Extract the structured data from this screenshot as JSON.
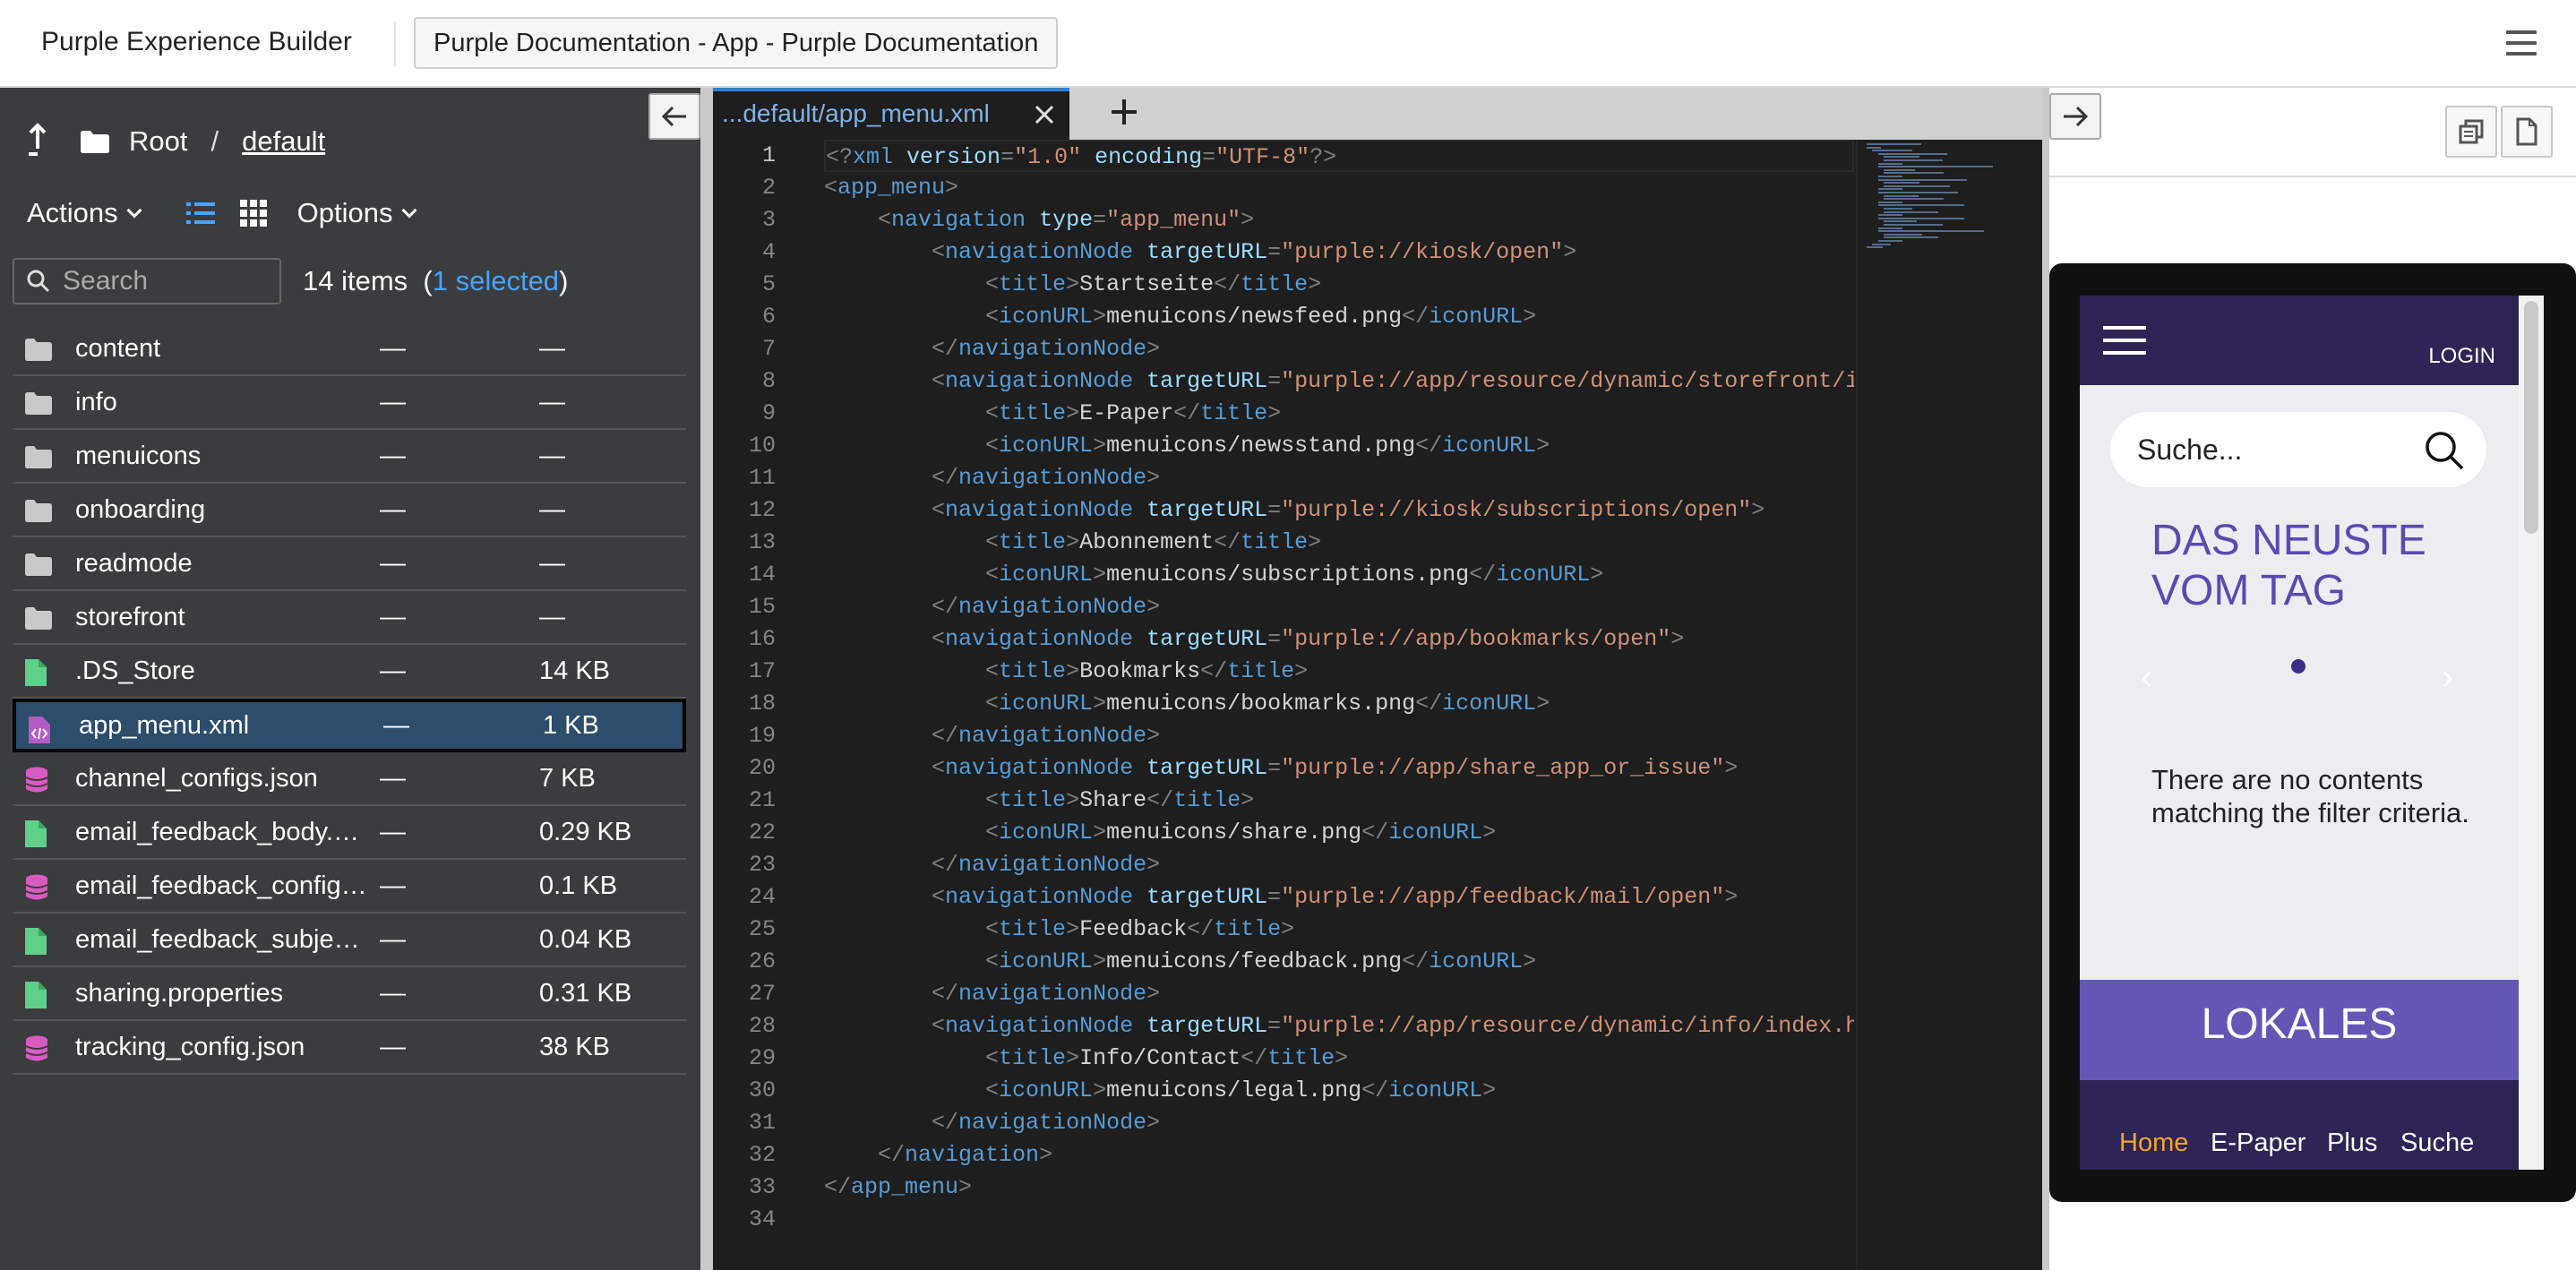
{
  "app": {
    "title": "Purple Experience Builder",
    "project_button": "Purple Documentation - App - Purple Documentation"
  },
  "browser": {
    "breadcrumb_root": "Root",
    "breadcrumb_sep": "/",
    "breadcrumb_current": "default",
    "actions_label": "Actions",
    "options_label": "Options",
    "search_placeholder": "Search",
    "items_count": "14 items",
    "paren_open": "(",
    "selected_count": "1 selected",
    "paren_close": ")",
    "files": [
      {
        "name": "content",
        "modified": "—",
        "size": "—",
        "type": "folder"
      },
      {
        "name": "info",
        "modified": "—",
        "size": "—",
        "type": "folder"
      },
      {
        "name": "menuicons",
        "modified": "—",
        "size": "—",
        "type": "folder"
      },
      {
        "name": "onboarding",
        "modified": "—",
        "size": "—",
        "type": "folder"
      },
      {
        "name": "readmode",
        "modified": "—",
        "size": "—",
        "type": "folder"
      },
      {
        "name": "storefront",
        "modified": "—",
        "size": "—",
        "type": "folder"
      },
      {
        "name": ".DS_Store",
        "modified": "—",
        "size": "14 KB",
        "type": "file"
      },
      {
        "name": "app_menu.xml",
        "modified": "—",
        "size": "1 KB",
        "type": "xml",
        "selected": true
      },
      {
        "name": "channel_configs.json",
        "modified": "—",
        "size": "7 KB",
        "type": "json"
      },
      {
        "name": "email_feedback_body.…",
        "modified": "—",
        "size": "0.29 KB",
        "type": "file"
      },
      {
        "name": "email_feedback_config…",
        "modified": "—",
        "size": "0.1 KB",
        "type": "json"
      },
      {
        "name": "email_feedback_subjec…",
        "modified": "—",
        "size": "0.04 KB",
        "type": "file"
      },
      {
        "name": "sharing.properties",
        "modified": "—",
        "size": "0.31 KB",
        "type": "file"
      },
      {
        "name": "tracking_config.json",
        "modified": "—",
        "size": "38 KB",
        "type": "json"
      }
    ]
  },
  "editor": {
    "tab_label": "...default/app_menu.xml",
    "current_line": 1,
    "lines": [
      [
        [
          "br",
          "<?"
        ],
        [
          "tag",
          "xml"
        ],
        [
          "attr",
          " version"
        ],
        [
          "br",
          "="
        ],
        [
          "str",
          "\"1.0\""
        ],
        [
          "attr",
          " encoding"
        ],
        [
          "br",
          "="
        ],
        [
          "str",
          "\"UTF-8\""
        ],
        [
          "br",
          "?>"
        ]
      ],
      [
        [
          "br",
          "<"
        ],
        [
          "tag",
          "app_menu"
        ],
        [
          "br",
          ">"
        ]
      ],
      [
        [
          "txt",
          "    "
        ],
        [
          "br",
          "<"
        ],
        [
          "tag",
          "navigation"
        ],
        [
          "attr",
          " type"
        ],
        [
          "br",
          "="
        ],
        [
          "str",
          "\"app_menu\""
        ],
        [
          "br",
          ">"
        ]
      ],
      [
        [
          "txt",
          "        "
        ],
        [
          "br",
          "<"
        ],
        [
          "tag",
          "navigationNode"
        ],
        [
          "attr",
          " targetURL"
        ],
        [
          "br",
          "="
        ],
        [
          "str",
          "\"purple://kiosk/open\""
        ],
        [
          "br",
          ">"
        ]
      ],
      [
        [
          "txt",
          "            "
        ],
        [
          "br",
          "<"
        ],
        [
          "tag",
          "title"
        ],
        [
          "br",
          ">"
        ],
        [
          "txt",
          "Startseite"
        ],
        [
          "br",
          "</"
        ],
        [
          "tag",
          "title"
        ],
        [
          "br",
          ">"
        ]
      ],
      [
        [
          "txt",
          "            "
        ],
        [
          "br",
          "<"
        ],
        [
          "tag",
          "iconURL"
        ],
        [
          "br",
          ">"
        ],
        [
          "txt",
          "menuicons/newsfeed.png"
        ],
        [
          "br",
          "</"
        ],
        [
          "tag",
          "iconURL"
        ],
        [
          "br",
          ">"
        ]
      ],
      [
        [
          "txt",
          "        "
        ],
        [
          "br",
          "</"
        ],
        [
          "tag",
          "navigationNode"
        ],
        [
          "br",
          ">"
        ]
      ],
      [
        [
          "txt",
          "        "
        ],
        [
          "br",
          "<"
        ],
        [
          "tag",
          "navigationNode"
        ],
        [
          "attr",
          " targetURL"
        ],
        [
          "br",
          "="
        ],
        [
          "str",
          "\"purple://app/resource/dynamic/storefront/index.html\""
        ],
        [
          "br",
          ">"
        ]
      ],
      [
        [
          "txt",
          "            "
        ],
        [
          "br",
          "<"
        ],
        [
          "tag",
          "title"
        ],
        [
          "br",
          ">"
        ],
        [
          "txt",
          "E-Paper"
        ],
        [
          "br",
          "</"
        ],
        [
          "tag",
          "title"
        ],
        [
          "br",
          ">"
        ]
      ],
      [
        [
          "txt",
          "            "
        ],
        [
          "br",
          "<"
        ],
        [
          "tag",
          "iconURL"
        ],
        [
          "br",
          ">"
        ],
        [
          "txt",
          "menuicons/newsstand.png"
        ],
        [
          "br",
          "</"
        ],
        [
          "tag",
          "iconURL"
        ],
        [
          "br",
          ">"
        ]
      ],
      [
        [
          "txt",
          "        "
        ],
        [
          "br",
          "</"
        ],
        [
          "tag",
          "navigationNode"
        ],
        [
          "br",
          ">"
        ]
      ],
      [
        [
          "txt",
          "        "
        ],
        [
          "br",
          "<"
        ],
        [
          "tag",
          "navigationNode"
        ],
        [
          "attr",
          " targetURL"
        ],
        [
          "br",
          "="
        ],
        [
          "str",
          "\"purple://kiosk/subscriptions/open\""
        ],
        [
          "br",
          ">"
        ]
      ],
      [
        [
          "txt",
          "            "
        ],
        [
          "br",
          "<"
        ],
        [
          "tag",
          "title"
        ],
        [
          "br",
          ">"
        ],
        [
          "txt",
          "Abonnement"
        ],
        [
          "br",
          "</"
        ],
        [
          "tag",
          "title"
        ],
        [
          "br",
          ">"
        ]
      ],
      [
        [
          "txt",
          "            "
        ],
        [
          "br",
          "<"
        ],
        [
          "tag",
          "iconURL"
        ],
        [
          "br",
          ">"
        ],
        [
          "txt",
          "menuicons/subscriptions.png"
        ],
        [
          "br",
          "</"
        ],
        [
          "tag",
          "iconURL"
        ],
        [
          "br",
          ">"
        ]
      ],
      [
        [
          "txt",
          "        "
        ],
        [
          "br",
          "</"
        ],
        [
          "tag",
          "navigationNode"
        ],
        [
          "br",
          ">"
        ]
      ],
      [
        [
          "txt",
          "        "
        ],
        [
          "br",
          "<"
        ],
        [
          "tag",
          "navigationNode"
        ],
        [
          "attr",
          " targetURL"
        ],
        [
          "br",
          "="
        ],
        [
          "str",
          "\"purple://app/bookmarks/open\""
        ],
        [
          "br",
          ">"
        ]
      ],
      [
        [
          "txt",
          "            "
        ],
        [
          "br",
          "<"
        ],
        [
          "tag",
          "title"
        ],
        [
          "br",
          ">"
        ],
        [
          "txt",
          "Bookmarks"
        ],
        [
          "br",
          "</"
        ],
        [
          "tag",
          "title"
        ],
        [
          "br",
          ">"
        ]
      ],
      [
        [
          "txt",
          "            "
        ],
        [
          "br",
          "<"
        ],
        [
          "tag",
          "iconURL"
        ],
        [
          "br",
          ">"
        ],
        [
          "txt",
          "menuicons/bookmarks.png"
        ],
        [
          "br",
          "</"
        ],
        [
          "tag",
          "iconURL"
        ],
        [
          "br",
          ">"
        ]
      ],
      [
        [
          "txt",
          "        "
        ],
        [
          "br",
          "</"
        ],
        [
          "tag",
          "navigationNode"
        ],
        [
          "br",
          ">"
        ]
      ],
      [
        [
          "txt",
          "        "
        ],
        [
          "br",
          "<"
        ],
        [
          "tag",
          "navigationNode"
        ],
        [
          "attr",
          " targetURL"
        ],
        [
          "br",
          "="
        ],
        [
          "str",
          "\"purple://app/share_app_or_issue\""
        ],
        [
          "br",
          ">"
        ]
      ],
      [
        [
          "txt",
          "            "
        ],
        [
          "br",
          "<"
        ],
        [
          "tag",
          "title"
        ],
        [
          "br",
          ">"
        ],
        [
          "txt",
          "Share"
        ],
        [
          "br",
          "</"
        ],
        [
          "tag",
          "title"
        ],
        [
          "br",
          ">"
        ]
      ],
      [
        [
          "txt",
          "            "
        ],
        [
          "br",
          "<"
        ],
        [
          "tag",
          "iconURL"
        ],
        [
          "br",
          ">"
        ],
        [
          "txt",
          "menuicons/share.png"
        ],
        [
          "br",
          "</"
        ],
        [
          "tag",
          "iconURL"
        ],
        [
          "br",
          ">"
        ]
      ],
      [
        [
          "txt",
          "        "
        ],
        [
          "br",
          "</"
        ],
        [
          "tag",
          "navigationNode"
        ],
        [
          "br",
          ">"
        ]
      ],
      [
        [
          "txt",
          "        "
        ],
        [
          "br",
          "<"
        ],
        [
          "tag",
          "navigationNode"
        ],
        [
          "attr",
          " targetURL"
        ],
        [
          "br",
          "="
        ],
        [
          "str",
          "\"purple://app/feedback/mail/open\""
        ],
        [
          "br",
          ">"
        ]
      ],
      [
        [
          "txt",
          "            "
        ],
        [
          "br",
          "<"
        ],
        [
          "tag",
          "title"
        ],
        [
          "br",
          ">"
        ],
        [
          "txt",
          "Feedback"
        ],
        [
          "br",
          "</"
        ],
        [
          "tag",
          "title"
        ],
        [
          "br",
          ">"
        ]
      ],
      [
        [
          "txt",
          "            "
        ],
        [
          "br",
          "<"
        ],
        [
          "tag",
          "iconURL"
        ],
        [
          "br",
          ">"
        ],
        [
          "txt",
          "menuicons/feedback.png"
        ],
        [
          "br",
          "</"
        ],
        [
          "tag",
          "iconURL"
        ],
        [
          "br",
          ">"
        ]
      ],
      [
        [
          "txt",
          "        "
        ],
        [
          "br",
          "</"
        ],
        [
          "tag",
          "navigationNode"
        ],
        [
          "br",
          ">"
        ]
      ],
      [
        [
          "txt",
          "        "
        ],
        [
          "br",
          "<"
        ],
        [
          "tag",
          "navigationNode"
        ],
        [
          "attr",
          " targetURL"
        ],
        [
          "br",
          "="
        ],
        [
          "str",
          "\"purple://app/resource/dynamic/info/index.html\""
        ],
        [
          "br",
          ">"
        ]
      ],
      [
        [
          "txt",
          "            "
        ],
        [
          "br",
          "<"
        ],
        [
          "tag",
          "title"
        ],
        [
          "br",
          ">"
        ],
        [
          "txt",
          "Info/Contact"
        ],
        [
          "br",
          "</"
        ],
        [
          "tag",
          "title"
        ],
        [
          "br",
          ">"
        ]
      ],
      [
        [
          "txt",
          "            "
        ],
        [
          "br",
          "<"
        ],
        [
          "tag",
          "iconURL"
        ],
        [
          "br",
          ">"
        ],
        [
          "txt",
          "menuicons/legal.png"
        ],
        [
          "br",
          "</"
        ],
        [
          "tag",
          "iconURL"
        ],
        [
          "br",
          ">"
        ]
      ],
      [
        [
          "txt",
          "        "
        ],
        [
          "br",
          "</"
        ],
        [
          "tag",
          "navigationNode"
        ],
        [
          "br",
          ">"
        ]
      ],
      [
        [
          "txt",
          "    "
        ],
        [
          "br",
          "</"
        ],
        [
          "tag",
          "navigation"
        ],
        [
          "br",
          ">"
        ]
      ],
      [
        [
          "br",
          "</"
        ],
        [
          "tag",
          "app_menu"
        ],
        [
          "br",
          ">"
        ]
      ],
      []
    ]
  },
  "preview": {
    "login": "LOGIN",
    "search_placeholder": "Suche...",
    "headline": "DAS NEUSTE VOM TAG",
    "empty_message": "There are no contents matching the filter criteria.",
    "section_title": "LOKALES",
    "nav": [
      {
        "label": "Home",
        "active": true
      },
      {
        "label": "E-Paper",
        "active": false
      },
      {
        "label": "Plus",
        "active": false
      },
      {
        "label": "Suche",
        "active": false
      }
    ],
    "colors": {
      "header": "#2e2455",
      "headline": "#5a4bb0",
      "section": "#6357b5",
      "active_nav": "#f5a623"
    }
  }
}
